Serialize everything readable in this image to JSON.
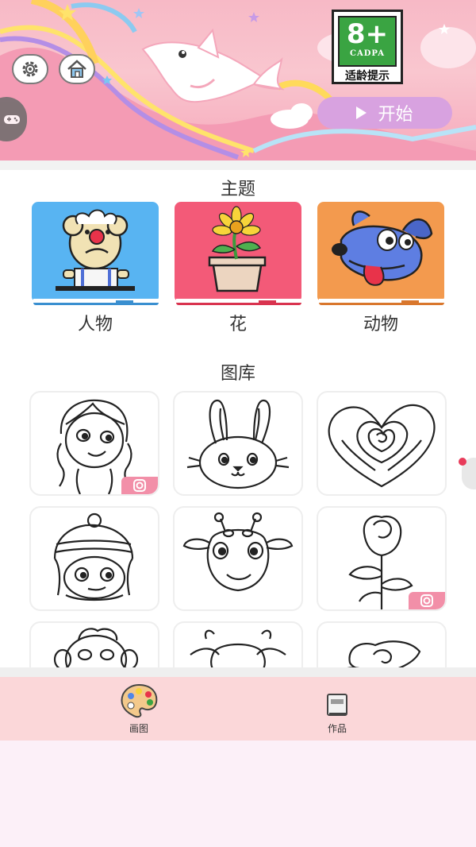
{
  "header": {
    "age_rating": {
      "number": "8+",
      "org": "CADPA",
      "tip": "适龄提示"
    },
    "start_button": {
      "label": "开始"
    },
    "icons": [
      "gear-icon",
      "home-icon",
      "gamepad-icon",
      "dolphin-illustration"
    ]
  },
  "themes": {
    "title": "主题",
    "items": [
      {
        "label": "人物",
        "color": "#58b4f2",
        "illustration": "clown-bear"
      },
      {
        "label": "花",
        "color": "#f35a78",
        "illustration": "potted-flower"
      },
      {
        "label": "动物",
        "color": "#f39a4e",
        "illustration": "cartoon-dog"
      }
    ]
  },
  "gallery": {
    "title": "图库",
    "items": [
      {
        "subject": "girl",
        "badge": true
      },
      {
        "subject": "rabbit",
        "badge": false
      },
      {
        "subject": "rose-heart",
        "badge": false
      },
      {
        "subject": "winter-girl",
        "badge": false
      },
      {
        "subject": "giraffe",
        "badge": false
      },
      {
        "subject": "rose",
        "badge": true
      },
      {
        "subject": "monkey",
        "badge": false
      },
      {
        "subject": "cow",
        "badge": false
      },
      {
        "subject": "roses",
        "badge": false
      }
    ]
  },
  "bottom_nav": {
    "items": [
      {
        "label": "画图",
        "icon": "palette-icon"
      },
      {
        "label": "作品",
        "icon": "book-icon"
      }
    ]
  },
  "colors": {
    "banner": "#f7b9c6",
    "start_button": "#d8a2e0",
    "nav_bg": "#fbd7d9",
    "badge_green": "#3aa442",
    "insta_badge": "#f28fa8"
  }
}
